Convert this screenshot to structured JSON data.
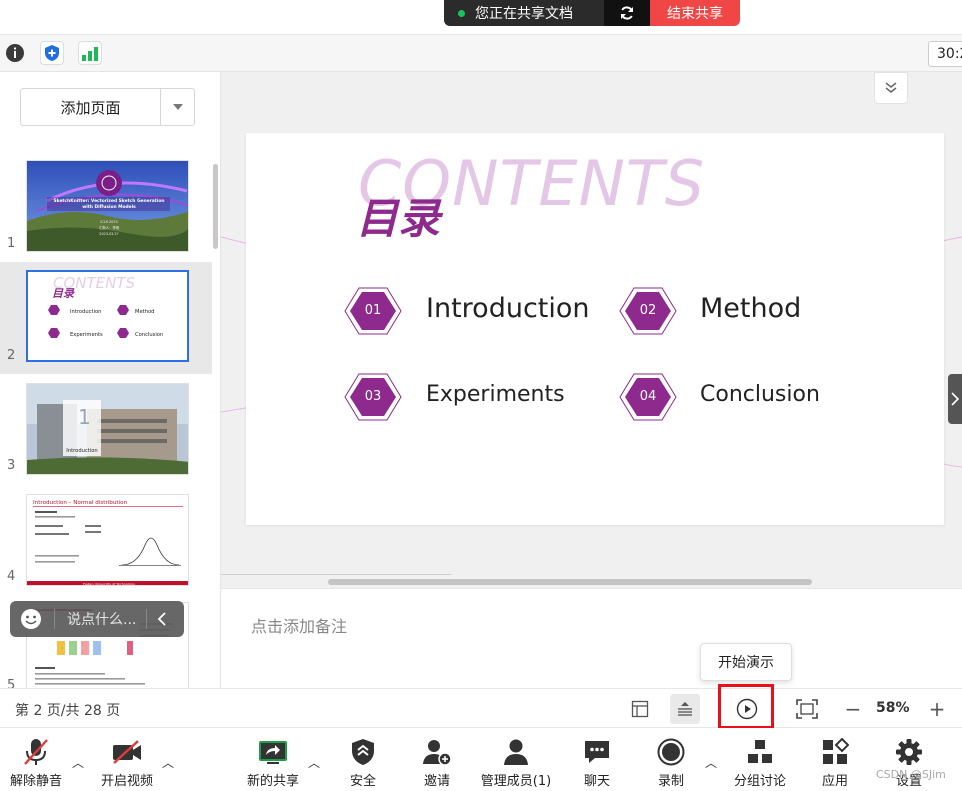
{
  "share_bar": {
    "status_text": "您正在共享文档",
    "stop_label": "结束共享"
  },
  "status_strip": {
    "timer": "30:2"
  },
  "thumbnails": {
    "add_page_label": "添加页面",
    "items": [
      {
        "num": "1",
        "title": "SketchKnitter: Vectorized Sketch Generation with Diffusion Models"
      },
      {
        "num": "2",
        "title": "CONTENTS",
        "subtitle": "目录",
        "entries": [
          "Introduction",
          "Method",
          "Experiments",
          "Conclusion"
        ]
      },
      {
        "num": "3",
        "big": "1",
        "caption": "Introduction"
      },
      {
        "num": "4",
        "title": "Introduction – Normal distribution"
      },
      {
        "num": "5",
        "title": ""
      }
    ],
    "selected_index": 2
  },
  "comment_bubble": {
    "placeholder": "说点什么..."
  },
  "slide": {
    "bg_title": "CONTENTS",
    "title": "目录",
    "items": [
      {
        "num": "01",
        "label": "Introduction"
      },
      {
        "num": "02",
        "label": "Method"
      },
      {
        "num": "03",
        "label": "Experiments"
      },
      {
        "num": "04",
        "label": "Conclusion"
      }
    ],
    "accent_color": "#8e2a8d"
  },
  "notes": {
    "placeholder": "点击添加备注"
  },
  "tooltip": {
    "text": "开始演示"
  },
  "page_bar": {
    "page_indicator": "第 2 页/共 28 页",
    "zoom": "58%",
    "zoom_out": "−",
    "zoom_in": "+"
  },
  "toolbar": {
    "items": [
      {
        "label": "解除静音",
        "icon": "mic-muted-icon"
      },
      {
        "label": "开启视频",
        "icon": "video-off-icon"
      },
      {
        "label": "新的共享",
        "icon": "share-screen-icon"
      },
      {
        "label": "安全",
        "icon": "shield-icon"
      },
      {
        "label": "邀请",
        "icon": "invite-user-icon"
      },
      {
        "label": "管理成员(1)",
        "icon": "members-icon"
      },
      {
        "label": "聊天",
        "icon": "chat-icon"
      },
      {
        "label": "录制",
        "icon": "record-icon"
      },
      {
        "label": "分组讨论",
        "icon": "breakout-icon"
      },
      {
        "label": "应用",
        "icon": "apps-icon"
      },
      {
        "label": "设置",
        "icon": "gear-icon"
      }
    ]
  },
  "watermark": "CSDN @SJim"
}
